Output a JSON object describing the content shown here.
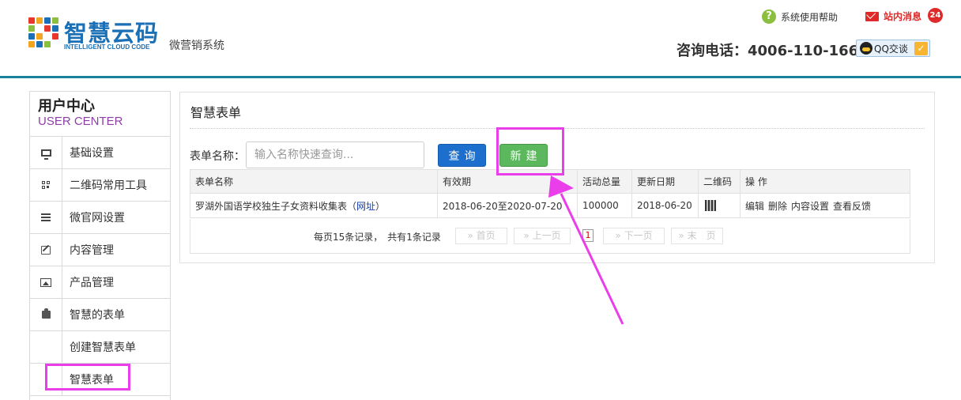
{
  "header": {
    "logo_title": "智慧云码",
    "logo_sub": "INTELLIGENT CLOUD CODE",
    "tagline": "微营销系统",
    "help_label": "系统使用帮助",
    "messages_label": "站内消息",
    "messages_count": "24",
    "phone": "咨询电话：4006-110-166",
    "qq_label": "QQ交谈",
    "accent_color": "#17829b"
  },
  "sidebar": {
    "title": "用户中心",
    "subtitle": "USER CENTER",
    "items": [
      {
        "label": "基础设置",
        "icon": "monitor-icon"
      },
      {
        "label": "二维码常用工具",
        "icon": "qrcode-icon"
      },
      {
        "label": "微官网设置",
        "icon": "list-icon"
      },
      {
        "label": "内容管理",
        "icon": "edit-icon"
      },
      {
        "label": "产品管理",
        "icon": "picture-icon"
      },
      {
        "label": "智慧的表单",
        "icon": "puzzle-icon"
      }
    ],
    "sub_items": [
      {
        "label": "创建智慧表单"
      },
      {
        "label": "智慧表单"
      }
    ]
  },
  "main": {
    "title": "智慧表单",
    "search_label": "表单名称：",
    "search_placeholder": "输入名称快速查询...",
    "query_button": "查询",
    "new_button": "新建",
    "table": {
      "headers": [
        "表单名称",
        "有效期",
        "活动总量",
        "更新日期",
        "二维码",
        "操 作"
      ],
      "rows": [
        {
          "name": "罗湖外国语学校独生子女资料收集表（",
          "link": "网址",
          "name_suffix": "）",
          "period": "2018-06-20至2020-07-20",
          "total": "100000",
          "updated": "2018-06-20",
          "qrcode": "qrcode-thumbnail",
          "ops": [
            "编辑",
            "删除",
            "内容设置",
            "查看反馈"
          ]
        }
      ]
    },
    "pager": {
      "summary": "每页15条记录，　共有1条记录",
      "first": "» 首页",
      "prev": "» 上一页",
      "current": "1",
      "next": "» 下一页",
      "last": "» 末　页"
    }
  },
  "annotation_color": "#e93ee9"
}
